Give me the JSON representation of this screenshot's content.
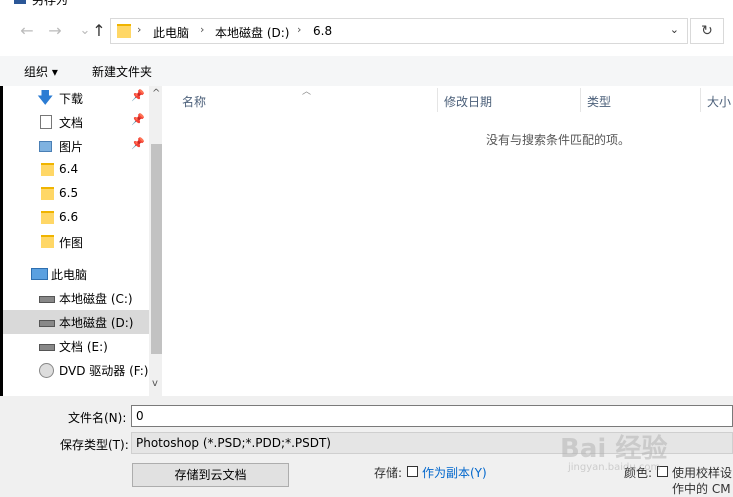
{
  "window": {
    "title": "另存为"
  },
  "nav": {
    "back": "←",
    "forward": "→",
    "up": "↑",
    "refresh": "↻",
    "dropdown": "⌄"
  },
  "address": {
    "crumbs": [
      "此电脑",
      "本地磁盘 (D:)",
      "6.8"
    ],
    "separator": "›"
  },
  "toolbar": {
    "organize": "组织 ▾",
    "new_folder": "新建文件夹"
  },
  "sidebar": {
    "items": [
      {
        "label": "下载",
        "icon": "download-icon",
        "pinned": true
      },
      {
        "label": "文档",
        "icon": "document-icon",
        "pinned": true
      },
      {
        "label": "图片",
        "icon": "picture-icon",
        "pinned": true
      },
      {
        "label": "6.4",
        "icon": "folder-icon"
      },
      {
        "label": "6.5",
        "icon": "folder-icon"
      },
      {
        "label": "6.6",
        "icon": "folder-icon"
      },
      {
        "label": "作图",
        "icon": "folder-icon"
      },
      {
        "label": "此电脑",
        "icon": "computer-icon"
      },
      {
        "label": "本地磁盘 (C:)",
        "icon": "drive-icon"
      },
      {
        "label": "本地磁盘 (D:)",
        "icon": "drive-icon",
        "selected": true
      },
      {
        "label": "文档 (E:)",
        "icon": "drive-icon"
      },
      {
        "label": "DVD 驱动器 (F:)",
        "icon": "dvd-icon"
      }
    ],
    "pin_glyph": "📌",
    "scroll_up": "^",
    "scroll_down": "v"
  },
  "columns": {
    "name": "名称",
    "modified": "修改日期",
    "type": "类型",
    "size": "大小"
  },
  "empty_message": "没有与搜索条件匹配的项。",
  "form": {
    "filename_label": "文件名(N):",
    "filename_value": "0",
    "filetype_label": "保存类型(T):",
    "filetype_value": "Photoshop (*.PSD;*.PDD;*.PSDT)",
    "cloud_button": "存储到云文档",
    "store_label": "存储:",
    "as_copy_label": "作为副本(Y)",
    "color_label": "颜色:",
    "use_proof_label": "使用校样设",
    "cmyk_label": "作中的 CM"
  },
  "watermark": {
    "main": "Bai 经验",
    "sub": "jingyan.baidu.com"
  }
}
